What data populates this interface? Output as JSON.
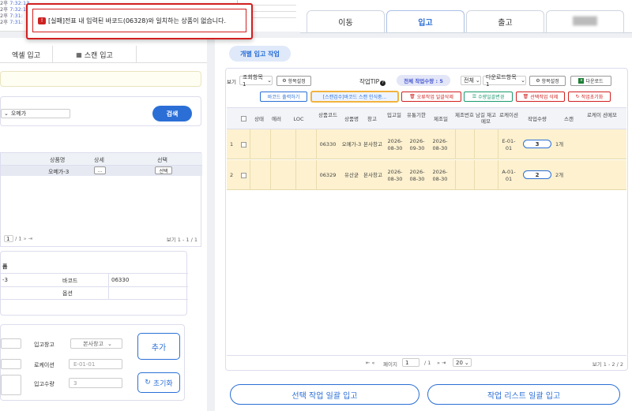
{
  "log": {
    "lines": [
      {
        "prefix": "2후",
        "time": "7:32:13",
        "text": ""
      },
      {
        "prefix": "2후",
        "time": "7:32:1",
        "text": ""
      },
      {
        "prefix": "2후",
        "time": "7:31:",
        "text": ""
      },
      {
        "prefix": "2후",
        "time": "7:31:",
        "text": ""
      }
    ]
  },
  "toast": {
    "message": "[실패]전표 내 입력된 바코드(06328)와 일치하는 상품이 없습니다."
  },
  "top_tabs": [
    "이동",
    "입고",
    "출고",
    "████"
  ],
  "left": {
    "tabs": [
      "엑셀 입고",
      "스캔 입고"
    ],
    "search": {
      "select_value": "오메가",
      "button": "검색"
    },
    "table": {
      "headers": [
        "상품명",
        "상세",
        "선택"
      ],
      "rows": [
        {
          "name": "오메가-3",
          "detail": "...",
          "select": "선택"
        }
      ],
      "pager": {
        "page": "1",
        "total": "/ 1",
        "info": "보기 1 - 1 / 1"
      }
    },
    "detail": {
      "header": "품",
      "name_value": "-3",
      "barcode_label": "바코드",
      "barcode_value": "06330",
      "option_label": "옵션",
      "option_value": ""
    },
    "form": {
      "warehouse_label": "입고창고",
      "warehouse_value": "본사창고",
      "location_label": "로케이션",
      "location_placeholder": "E-01-01",
      "qty_label": "입고수량",
      "qty_value": "3",
      "add_button": "추가",
      "reset_button": "초기화"
    }
  },
  "right": {
    "section_title": "개별 입고 작업",
    "toolbar": {
      "view_label": "보기",
      "view_select": "조회항목1",
      "column_settings": "항목설정",
      "tip_label": "작업TIP",
      "total_badge": "전체 작업수량 : 5",
      "filter_select": "전체",
      "download_select": "다운로드항목1",
      "column_settings2": "항목설정",
      "download": "다운로드"
    },
    "actions": [
      "바코드 출력하기",
      "[스캔검수]바코드 스캔 인식중...",
      "오류작업 일괄삭제",
      "수량일괄변경",
      "선택작업 삭제",
      "작업초기화"
    ],
    "columns": [
      "상태",
      "에러",
      "LOC",
      "상품코드",
      "상품명",
      "창고",
      "입고일",
      "유통기한",
      "제조일",
      "제조번호",
      "남길 재고메모",
      "로케이션",
      "작업수량",
      "스캔",
      "로케이 션메모"
    ],
    "rows": [
      {
        "num": "1",
        "code": "06330",
        "name": "오메가-3",
        "warehouse": "본사창고",
        "in_date": "2026-08-30",
        "exp_date": "2026-09-30",
        "mfg_date": "2026-08-30",
        "location": "E-01-01",
        "qty": "3",
        "scan": "1개"
      },
      {
        "num": "2",
        "code": "06329",
        "name": "유산균",
        "warehouse": "본사창고",
        "in_date": "2026-08-30",
        "exp_date": "2026-08-30",
        "mfg_date": "2026-08-30",
        "location": "A-01-01",
        "qty": "2",
        "scan": "2개"
      }
    ],
    "pager": {
      "page_label": "페이지",
      "page": "1",
      "total": "/ 1",
      "size": "20",
      "info": "보기 1 - 2 / 2"
    },
    "buttons": [
      "선택 작업 일괄 입고",
      "작업 리스트 일괄 입고"
    ]
  },
  "colors": {
    "accent": "#2b6fd6",
    "error": "#d21f1f",
    "row_highlight": "#fdf1cf"
  }
}
